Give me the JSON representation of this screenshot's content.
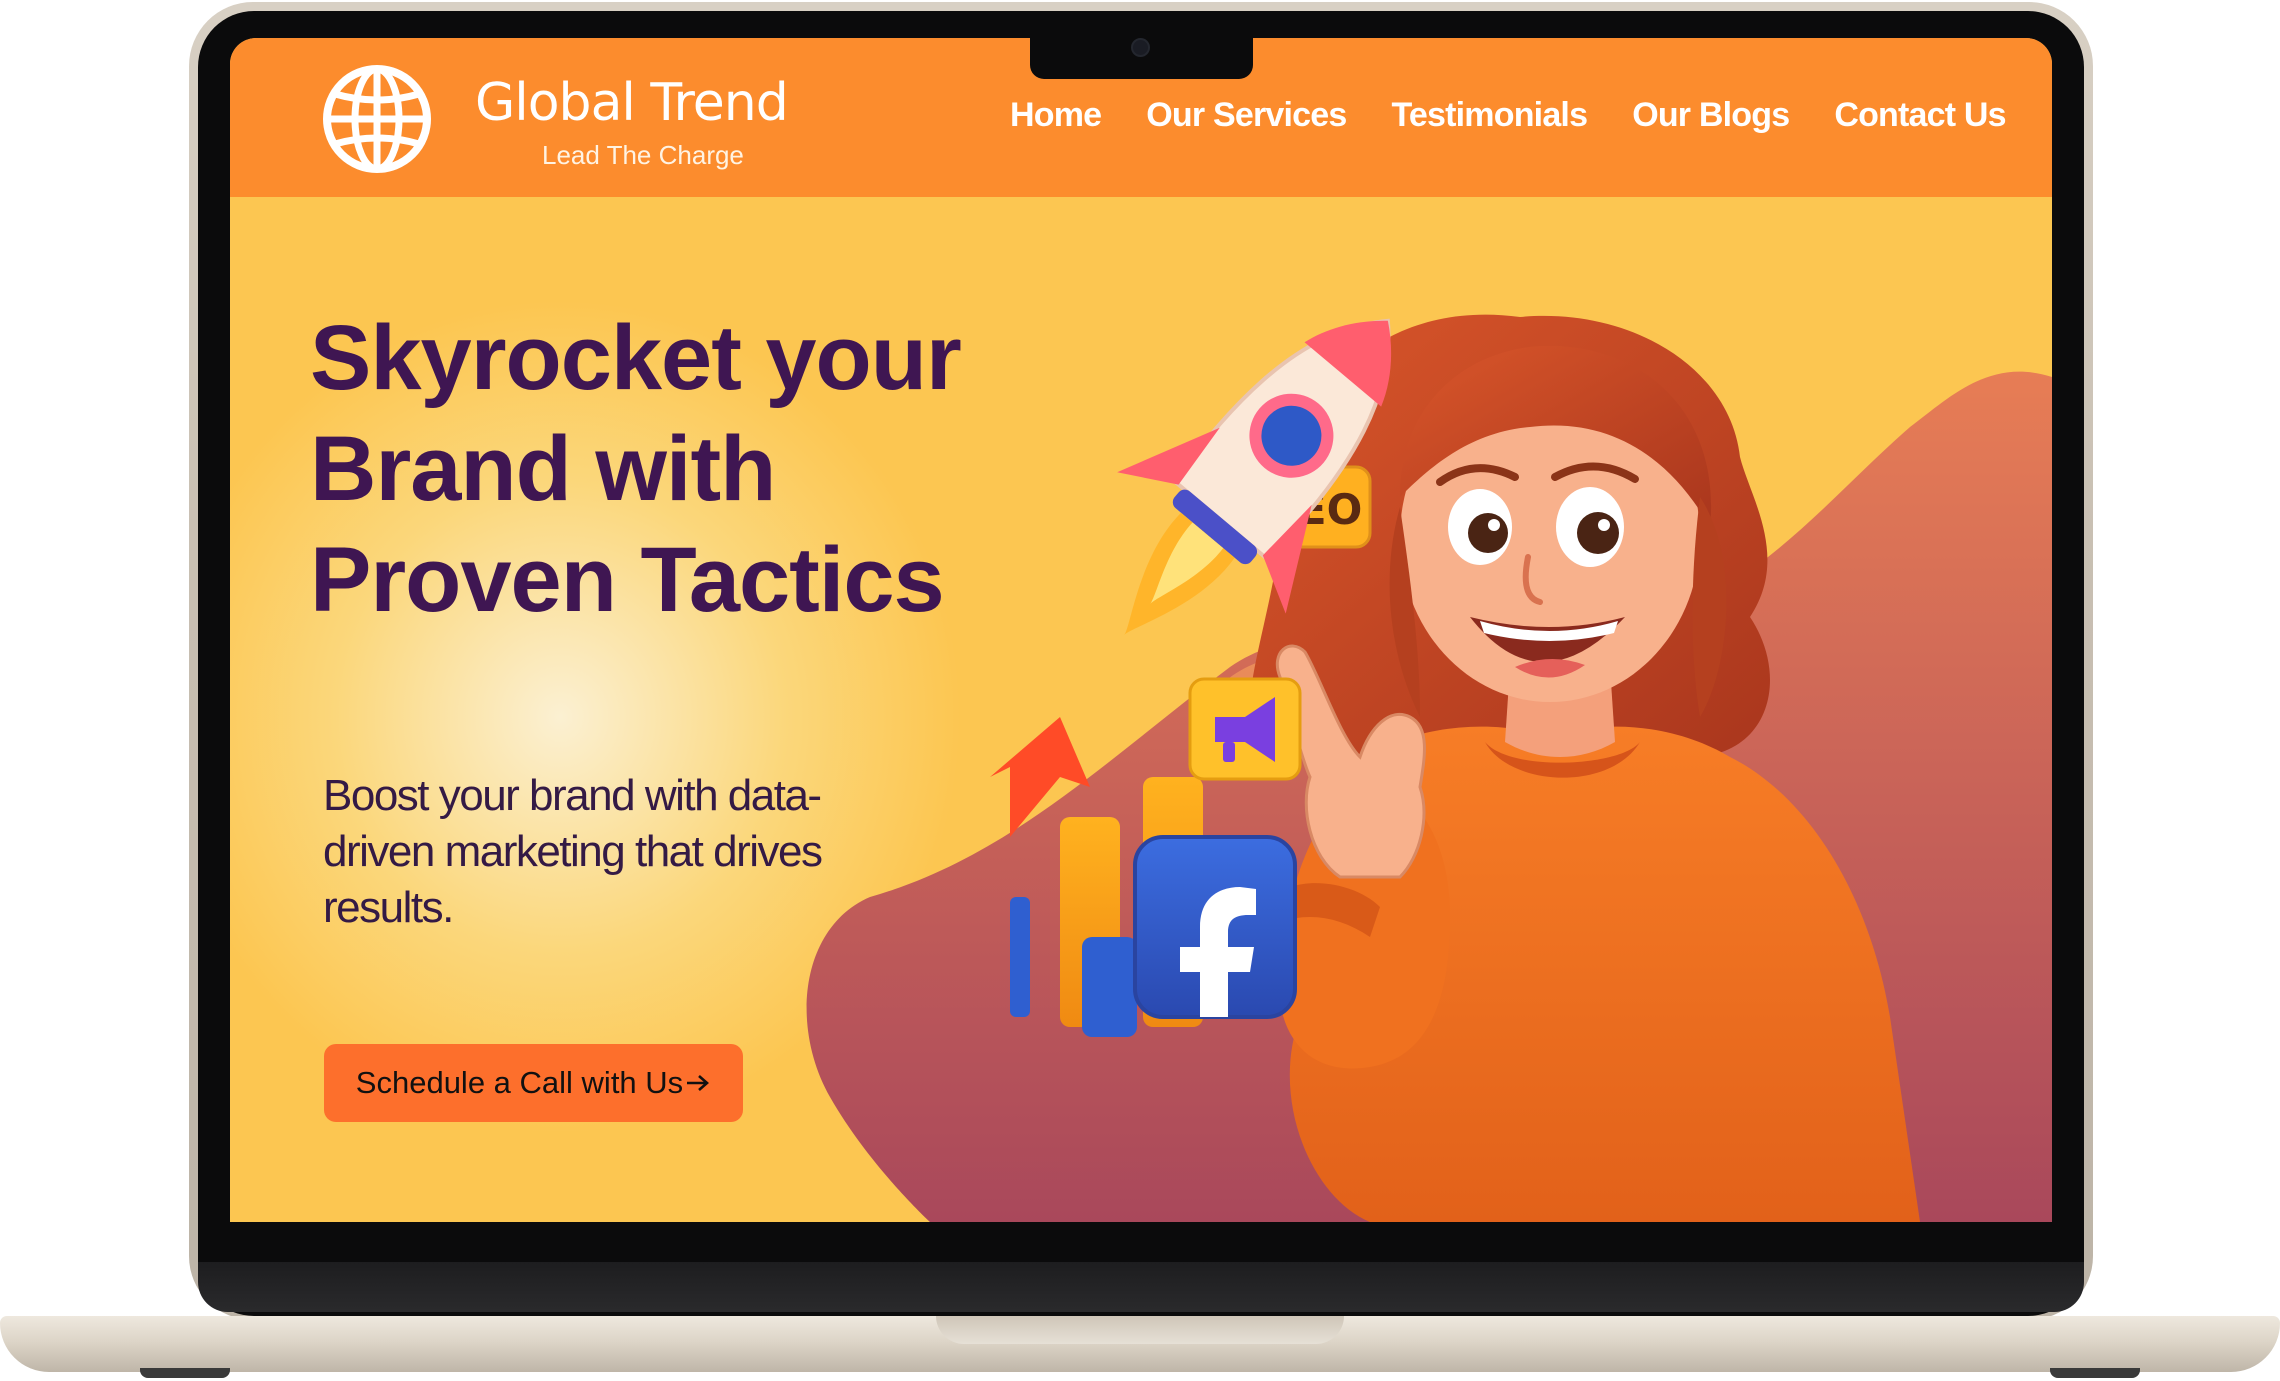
{
  "brand": {
    "name": "Global Trend",
    "tagline": "Lead The Charge"
  },
  "nav": {
    "items": [
      "Home",
      "Our Services",
      "Testimonials",
      "Our Blogs",
      "Contact Us"
    ]
  },
  "hero": {
    "headline": "Skyrocket your Brand with Proven Tactics",
    "subtext": "Boost your brand with data-driven marketing that drives results.",
    "cta_label": "Schedule a Call with Us",
    "cta_icon": "arrow-right-icon",
    "seo_badge": "SEO"
  },
  "colors": {
    "header": "#fc8c2d",
    "hero_background": "#fcc754",
    "headline": "#3f1652",
    "cta": "#fd6f2c"
  }
}
